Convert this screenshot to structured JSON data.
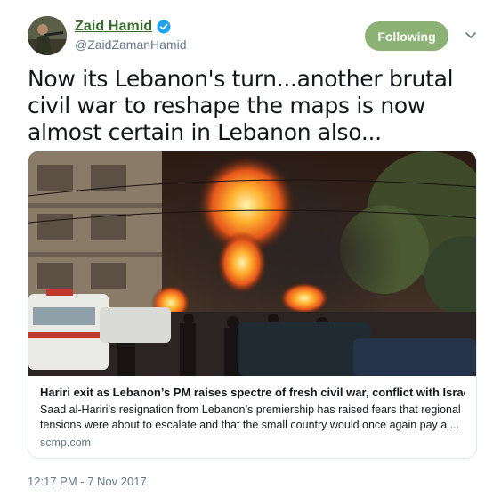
{
  "user": {
    "display_name": "Zaid Hamid",
    "handle": "@ZaidZamanHamid",
    "verified": true
  },
  "follow_button": {
    "label": "Following"
  },
  "tweet": {
    "text": "Now its Lebanon's turn...another brutal civil war to reshape the maps is now almost certain in Lebanon also...",
    "timestamp": "12:17 PM - 7 Nov 2017"
  },
  "card": {
    "title": "Hariri exit as Lebanon’s PM raises spectre of fresh civil war, conflict with Israel",
    "description": "Saad al-Hariri’s resignation from Lebanon’s premiership has raised fears that regional tensions were about to escalate and that the small country would once again pay a ...",
    "domain": "scmp.com"
  },
  "icons": {
    "verified": "verified-badge-icon",
    "caret": "chevron-down-icon"
  },
  "colors": {
    "display_name": "#3a6b2e",
    "follow_button": "#8bb174",
    "verified": "#1da1f2",
    "secondary_text": "#657786",
    "card_border": "#e1e8ed"
  }
}
